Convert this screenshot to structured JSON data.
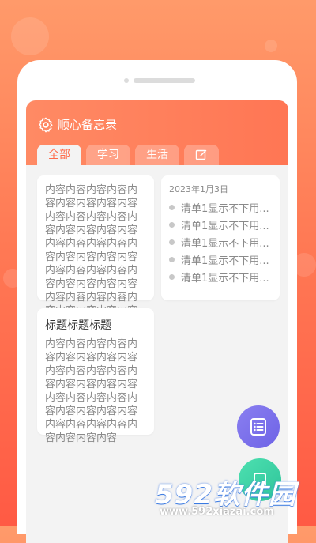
{
  "app": {
    "title": "顺心备忘录"
  },
  "tabs": [
    {
      "label": "全部",
      "active": true
    },
    {
      "label": "学习",
      "active": false
    },
    {
      "label": "生活",
      "active": false
    },
    {
      "icon": "edit-icon"
    }
  ],
  "notes": [
    {
      "type": "text",
      "title": "",
      "content": "内容内容内容内容内容内容内容内容内容内容内容内容内容内容内容内容内容内容内容内容内容内容内容内容内容内容内容内容内容内容内容内容内容内容内容内容内容内容内容内容内容内容内容内容内容内容内容内容内容内容内容内容内容内容内容内容内容"
    },
    {
      "type": "checklist",
      "date": "2023年1月3日",
      "items": [
        "清单1显示不下用...",
        "清单1显示不下用...",
        "清单1显示不下用...",
        "清单1显示不下用...",
        "清单1显示不下用..."
      ]
    },
    {
      "type": "text",
      "title": "标题标题标题",
      "content": "内容内容内容内容内容内容内容内容内容内容内容内容内容内容内容内容内容内容内容内容内容内容内容内容内容内容内容内容内容内容内容内容内容内容内容"
    }
  ],
  "fabs": [
    {
      "icon": "list-icon"
    },
    {
      "icon": "note-icon"
    }
  ],
  "watermark": {
    "main": "592软件园",
    "sub": "www.592xiazai.com"
  },
  "colors": {
    "accent": "#ff7654",
    "fab_purple": "#7a6fec",
    "fab_green": "#3ad2a4"
  }
}
